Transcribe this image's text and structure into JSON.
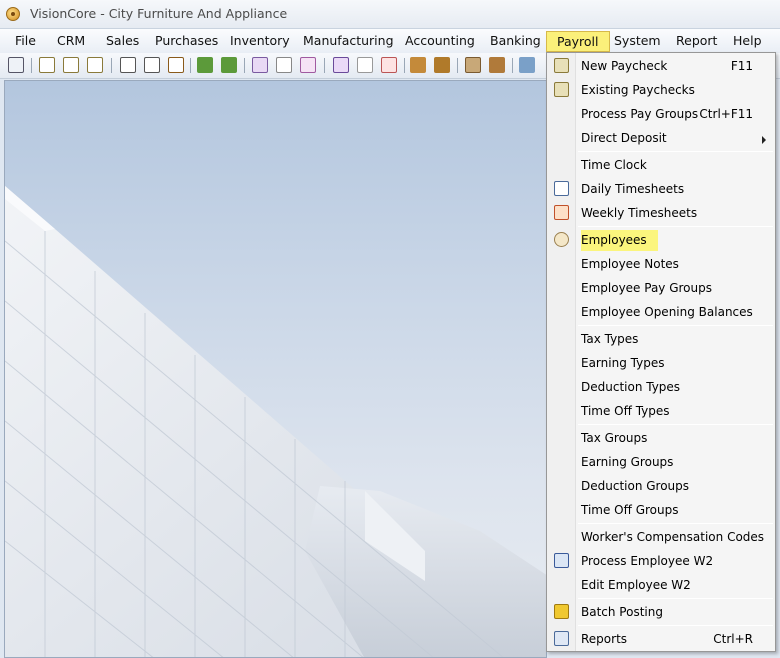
{
  "window": {
    "title": "VisionCore - City Furniture And Appliance"
  },
  "menubar": {
    "items": [
      {
        "label": "File"
      },
      {
        "label": "CRM"
      },
      {
        "label": "Sales"
      },
      {
        "label": "Purchases"
      },
      {
        "label": "Inventory"
      },
      {
        "label": "Manufacturing"
      },
      {
        "label": "Accounting"
      },
      {
        "label": "Banking"
      },
      {
        "label": "Payroll"
      },
      {
        "label": "System"
      },
      {
        "label": "Report"
      },
      {
        "label": "Help"
      }
    ],
    "active": "Payroll"
  },
  "payroll_menu": {
    "items": [
      {
        "label": "New Paycheck",
        "shortcut": "F11",
        "icon": "paycheck-icon"
      },
      {
        "label": "Existing Paychecks",
        "shortcut": "",
        "icon": "paychecks-icon"
      },
      {
        "label": "Process Pay Groups",
        "shortcut": "Ctrl+F11"
      },
      {
        "label": "Direct Deposit",
        "shortcut": "",
        "submenu": true
      },
      {
        "label": "Time Clock"
      },
      {
        "label": "Daily Timesheets",
        "icon": "daily-timesheet-icon"
      },
      {
        "label": "Weekly Timesheets",
        "icon": "weekly-timesheet-icon"
      },
      {
        "label": "Employees",
        "icon": "employee-icon",
        "highlighted": true
      },
      {
        "label": "Employee Notes"
      },
      {
        "label": "Employee Pay Groups"
      },
      {
        "label": "Employee Opening Balances"
      },
      {
        "label": "Tax Types"
      },
      {
        "label": "Earning Types"
      },
      {
        "label": "Deduction Types"
      },
      {
        "label": "Time Off Types"
      },
      {
        "label": "Tax Groups"
      },
      {
        "label": "Earning Groups"
      },
      {
        "label": "Deduction Groups"
      },
      {
        "label": "Time Off Groups"
      },
      {
        "label": "Worker's Compensation Codes"
      },
      {
        "label": "Process Employee W2",
        "icon": "w2-icon"
      },
      {
        "label": "Edit Employee W2"
      },
      {
        "label": "Batch Posting",
        "icon": "batch-posting-icon"
      },
      {
        "label": "Reports",
        "shortcut": "Ctrl+R",
        "icon": "reports-icon"
      }
    ]
  },
  "colors": {
    "highlight": "#fbf57d",
    "menu_active": "#fbf07a"
  }
}
